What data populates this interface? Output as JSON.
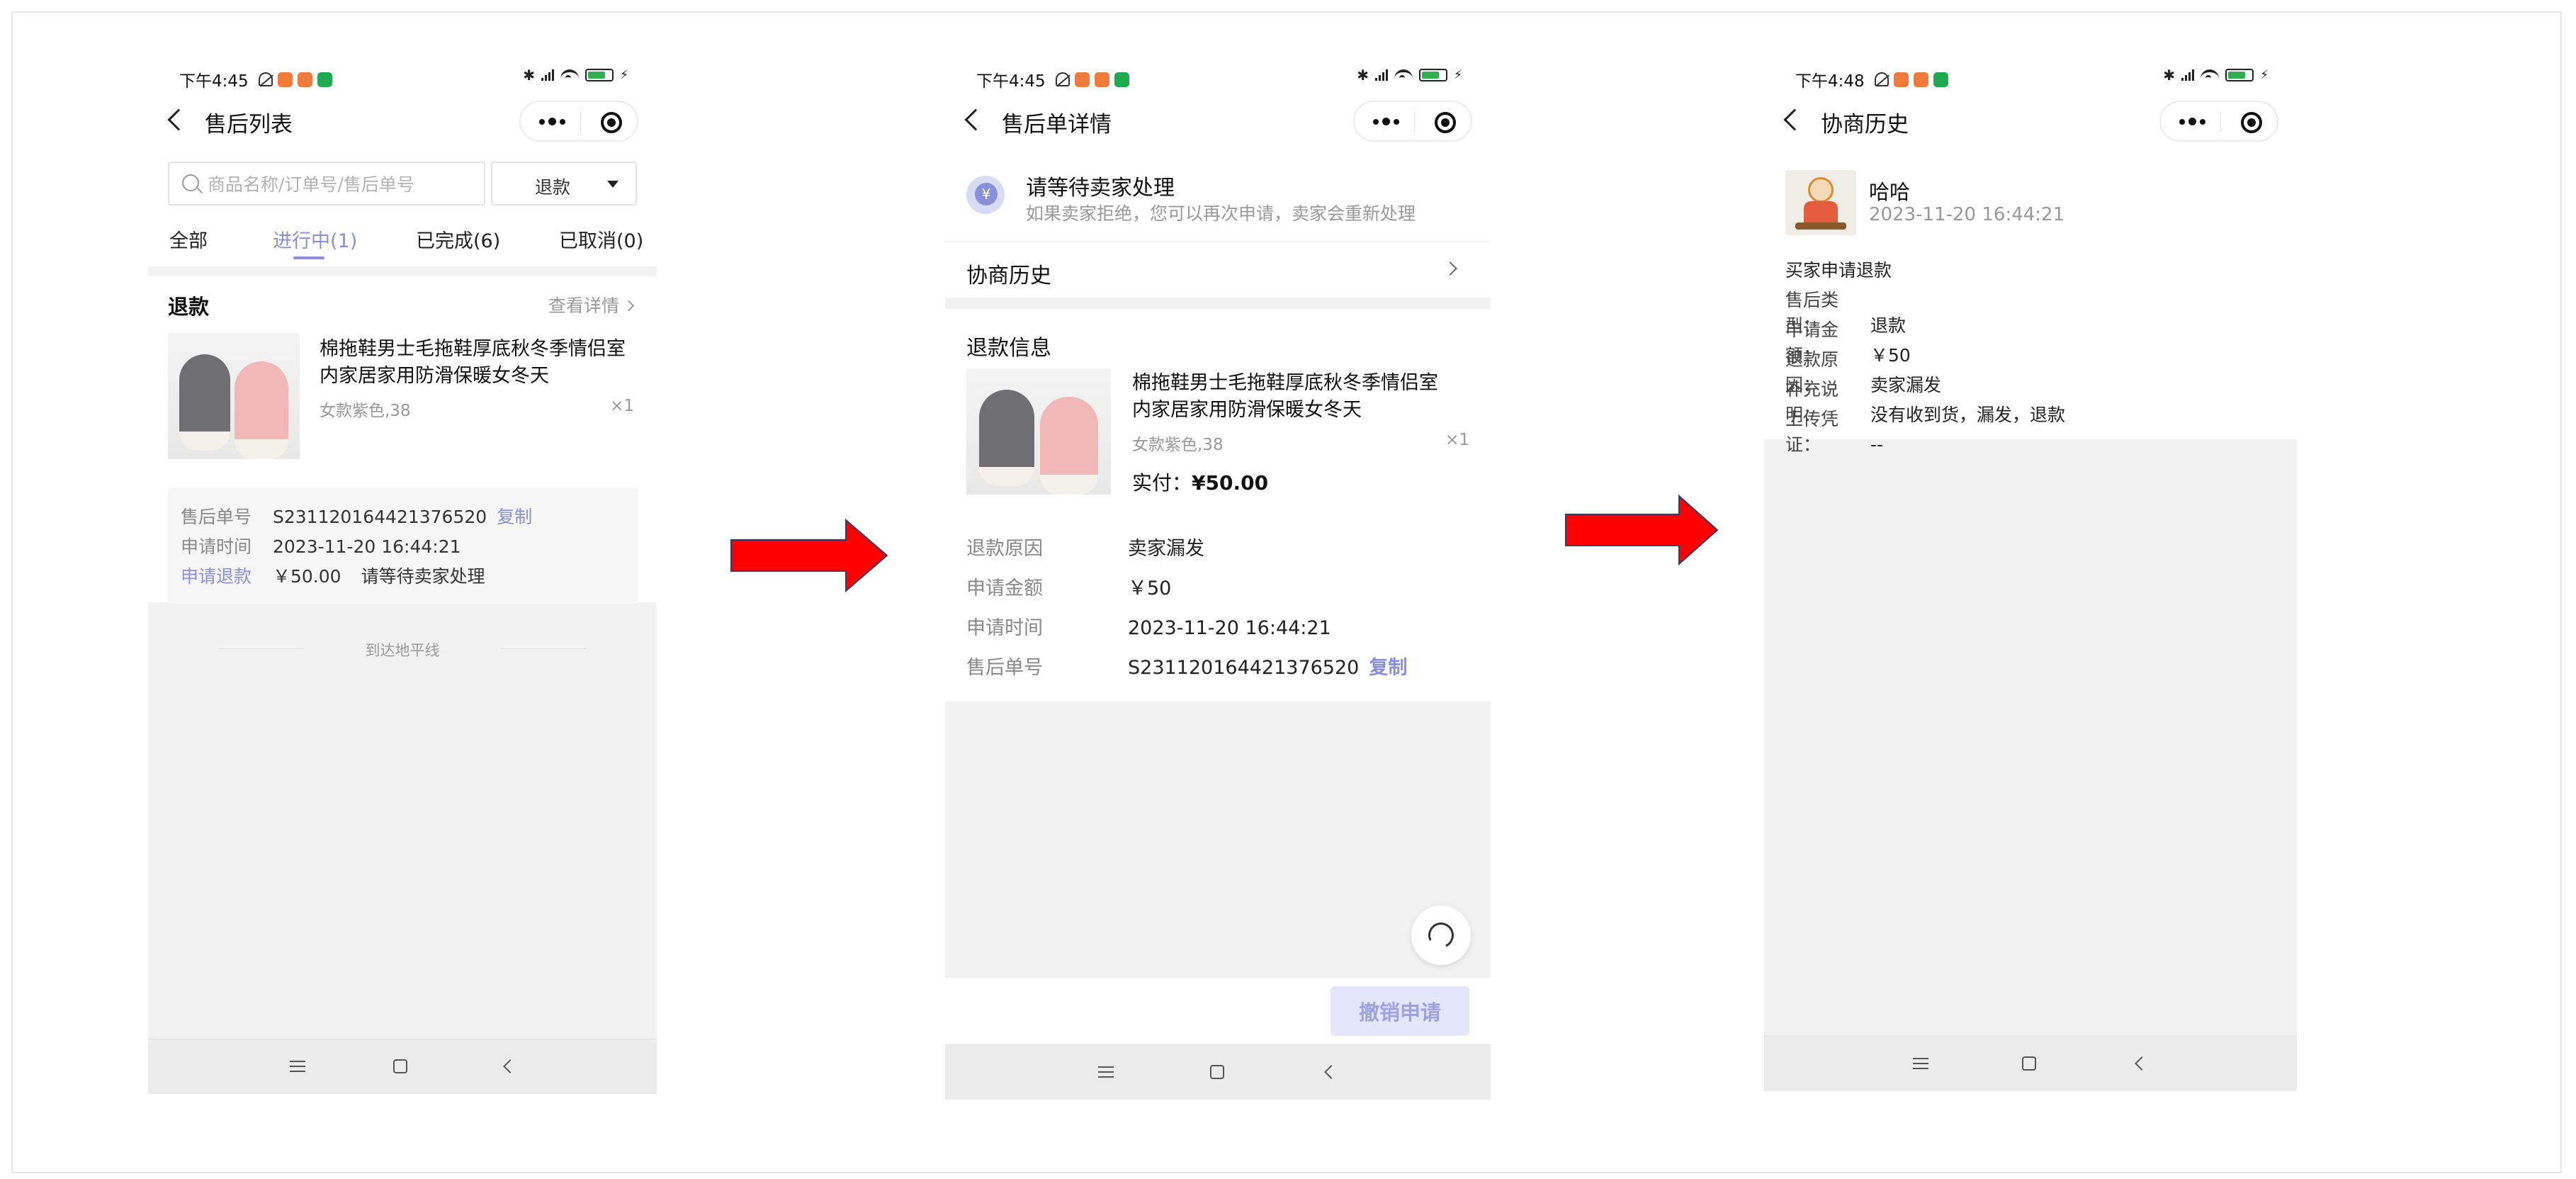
{
  "status": {
    "time1": "下午4:45",
    "time2": "下午4:45",
    "time3": "下午4:48",
    "bluetooth": "✱",
    "charge": "⚡"
  },
  "screen1": {
    "title": "售后列表",
    "search_placeholder": "商品名称/订单号/售后单号",
    "filter_value": "退款",
    "tabs": [
      {
        "label": "全部"
      },
      {
        "label": "进行中(1)"
      },
      {
        "label": "已完成(6)"
      },
      {
        "label": "已取消(0)"
      }
    ],
    "card": {
      "type": "退款",
      "view_detail": "查看详情",
      "product_name_line1": "棉拖鞋男士毛拖鞋厚底秋冬季情侣室",
      "product_name_line2": "内家居家用防滑保暖女冬天",
      "spec": "女款紫色,38",
      "qty": "×1",
      "order_label": "售后单号",
      "order_no": "S231120164421376520",
      "copy": "复制",
      "time_label": "申请时间",
      "time": "2023-11-20 16:44:21",
      "refund_label": "申请退款",
      "refund_amount": "￥50.00",
      "refund_status": "请等待卖家处理"
    },
    "end_of_list": "到达地平线"
  },
  "screen2": {
    "title": "售后单详情",
    "wait_title": "请等待卖家处理",
    "wait_sub": "如果卖家拒绝，您可以再次申请，卖家会重新处理",
    "history_label": "协商历史",
    "section_title": "退款信息",
    "product_name_line1": "棉拖鞋男士毛拖鞋厚底秋冬季情侣室",
    "product_name_line2": "内家居家用防滑保暖女冬天",
    "spec": "女款紫色,38",
    "qty": "×1",
    "paid_label": "实付：",
    "paid_amount": "¥50.00",
    "reason_label": "退款原因",
    "reason": "卖家漏发",
    "amount_label": "申请金额",
    "amount": "￥50",
    "time_label": "申请时间",
    "time": "2023-11-20 16:44:21",
    "order_label": "售后单号",
    "order_no": "S231120164421376520",
    "copy": "复制",
    "cancel_button": "撤销申请"
  },
  "screen3": {
    "title": "协商历史",
    "user_name": "哈哈",
    "user_time": "2023-11-20 16:44:21",
    "heading": "买家申请退款",
    "type_label": "售后类型：",
    "type": "退款",
    "amount_label": "申请金额：",
    "amount": "￥50",
    "reason_label": "退款原因：",
    "reason": "卖家漏发",
    "note_label": "补充说明：",
    "note": "没有收到货，漏发，退款",
    "proof_label": "上传凭证：",
    "proof": "--"
  },
  "colors": {
    "accent": "#8a8fd9",
    "arrow": "#ff0000",
    "cancel_bg": "#e4e6fb"
  }
}
